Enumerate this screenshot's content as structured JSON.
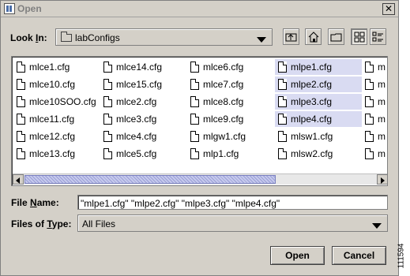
{
  "window": {
    "title": "Open",
    "close_glyph": "✕"
  },
  "look_in": {
    "label_pre": "Look ",
    "label_u": "I",
    "label_post": "n:",
    "value": "labConfigs",
    "folder_icon": "folder-icon"
  },
  "toolbar": {
    "buttons": [
      "up-one-level-icon",
      "home-icon",
      "new-folder-icon",
      "list-view-icon",
      "details-view-icon"
    ]
  },
  "files": [
    {
      "name": "mlce1.cfg",
      "selected": false
    },
    {
      "name": "mlce10.cfg",
      "selected": false
    },
    {
      "name": "mlce10SOO.cfg",
      "selected": false
    },
    {
      "name": "mlce11.cfg",
      "selected": false
    },
    {
      "name": "mlce12.cfg",
      "selected": false
    },
    {
      "name": "mlce13.cfg",
      "selected": false
    },
    {
      "name": "mlce14.cfg",
      "selected": false
    },
    {
      "name": "mlce15.cfg",
      "selected": false
    },
    {
      "name": "mlce2.cfg",
      "selected": false
    },
    {
      "name": "mlce3.cfg",
      "selected": false
    },
    {
      "name": "mlce4.cfg",
      "selected": false
    },
    {
      "name": "mlce5.cfg",
      "selected": false
    },
    {
      "name": "mlce6.cfg",
      "selected": false
    },
    {
      "name": "mlce7.cfg",
      "selected": false
    },
    {
      "name": "mlce8.cfg",
      "selected": false
    },
    {
      "name": "mlce9.cfg",
      "selected": false
    },
    {
      "name": "mlgw1.cfg",
      "selected": false
    },
    {
      "name": "mlp1.cfg",
      "selected": false
    },
    {
      "name": "mlpe1.cfg",
      "selected": true
    },
    {
      "name": "mlpe2.cfg",
      "selected": true
    },
    {
      "name": "mlpe3.cfg",
      "selected": true
    },
    {
      "name": "mlpe4.cfg",
      "selected": true
    },
    {
      "name": "mlsw1.cfg",
      "selected": false
    },
    {
      "name": "mlsw2.cfg",
      "selected": false
    },
    {
      "name": "m",
      "selected": false
    },
    {
      "name": "m",
      "selected": false
    },
    {
      "name": "m",
      "selected": false
    },
    {
      "name": "m",
      "selected": false
    },
    {
      "name": "m",
      "selected": false
    },
    {
      "name": "m",
      "selected": false
    }
  ],
  "file_name": {
    "label_pre": "File ",
    "label_u": "N",
    "label_post": "ame:",
    "value": "\"mlpe1.cfg\" \"mlpe2.cfg\" \"mlpe3.cfg\" \"mlpe4.cfg\""
  },
  "file_type": {
    "label_pre": "Files of ",
    "label_u": "T",
    "label_post": "ype:",
    "value": "All Files"
  },
  "buttons": {
    "open": "Open",
    "cancel": "Cancel"
  },
  "side_id": "111594"
}
